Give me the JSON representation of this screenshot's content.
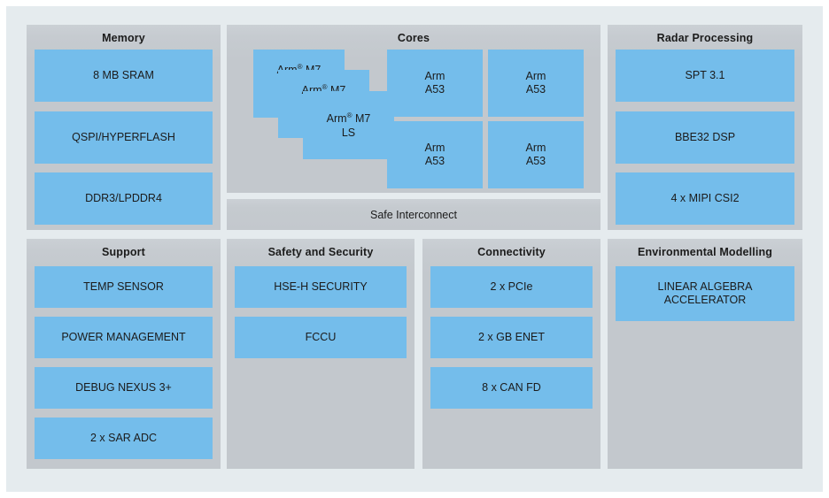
{
  "theme": {
    "canvas_background": "#ffffff",
    "page_background": "#e5ebee",
    "panel_gray": "#c3c8cd",
    "block_blue": "#74bdeb",
    "text_color": "#1b1b1b"
  },
  "diagram": {
    "type": "block-diagram",
    "panels": [
      {
        "id": "memory",
        "title": "Memory",
        "blocks": [
          {
            "label": "8 MB SRAM"
          },
          {
            "label": "QSPI/HYPERFLASH"
          },
          {
            "label": "DDR3/LPDDR4"
          }
        ]
      },
      {
        "id": "cores",
        "title": "Cores",
        "stacked_cards": [
          {
            "line1": "Arm",
            "reg": "®",
            "line1b": " M7",
            "line2": ""
          },
          {
            "line1": "Arm",
            "reg": "®",
            "line1b": " M7",
            "line2": ""
          },
          {
            "line1": "Arm",
            "reg": "®",
            "line1b": " M7",
            "line2": "LS"
          }
        ],
        "grid_blocks": [
          {
            "line1": "Arm",
            "line2": "A53"
          },
          {
            "line1": "Arm",
            "line2": "A53"
          },
          {
            "line1": "Arm",
            "line2": "A53"
          },
          {
            "line1": "Arm",
            "line2": "A53"
          }
        ],
        "interconnect_label": "Safe Interconnect"
      },
      {
        "id": "radar-processing",
        "title": "Radar Processing",
        "blocks": [
          {
            "label": "SPT 3.1"
          },
          {
            "label": "BBE32 DSP"
          },
          {
            "label": "4 x MIPI CSI2"
          }
        ]
      },
      {
        "id": "support",
        "title": "Support",
        "blocks": [
          {
            "label": "TEMP SENSOR"
          },
          {
            "label": "POWER MANAGEMENT"
          },
          {
            "label": "DEBUG NEXUS 3+"
          },
          {
            "label": "2 x SAR ADC"
          }
        ]
      },
      {
        "id": "safety-and-security",
        "title": "Safety and Security",
        "blocks": [
          {
            "label": "HSE-H SECURITY"
          },
          {
            "label": "FCCU"
          }
        ]
      },
      {
        "id": "connectivity",
        "title": "Connectivity",
        "blocks": [
          {
            "label": "2 x PCIe"
          },
          {
            "label": "2 x GB ENET"
          },
          {
            "label": "8 x CAN FD"
          }
        ]
      },
      {
        "id": "environmental-modelling",
        "title": "Environmental Modelling",
        "blocks": [
          {
            "line1": "LINEAR ALGEBRA",
            "line2": "ACCELERATOR"
          }
        ]
      }
    ]
  }
}
